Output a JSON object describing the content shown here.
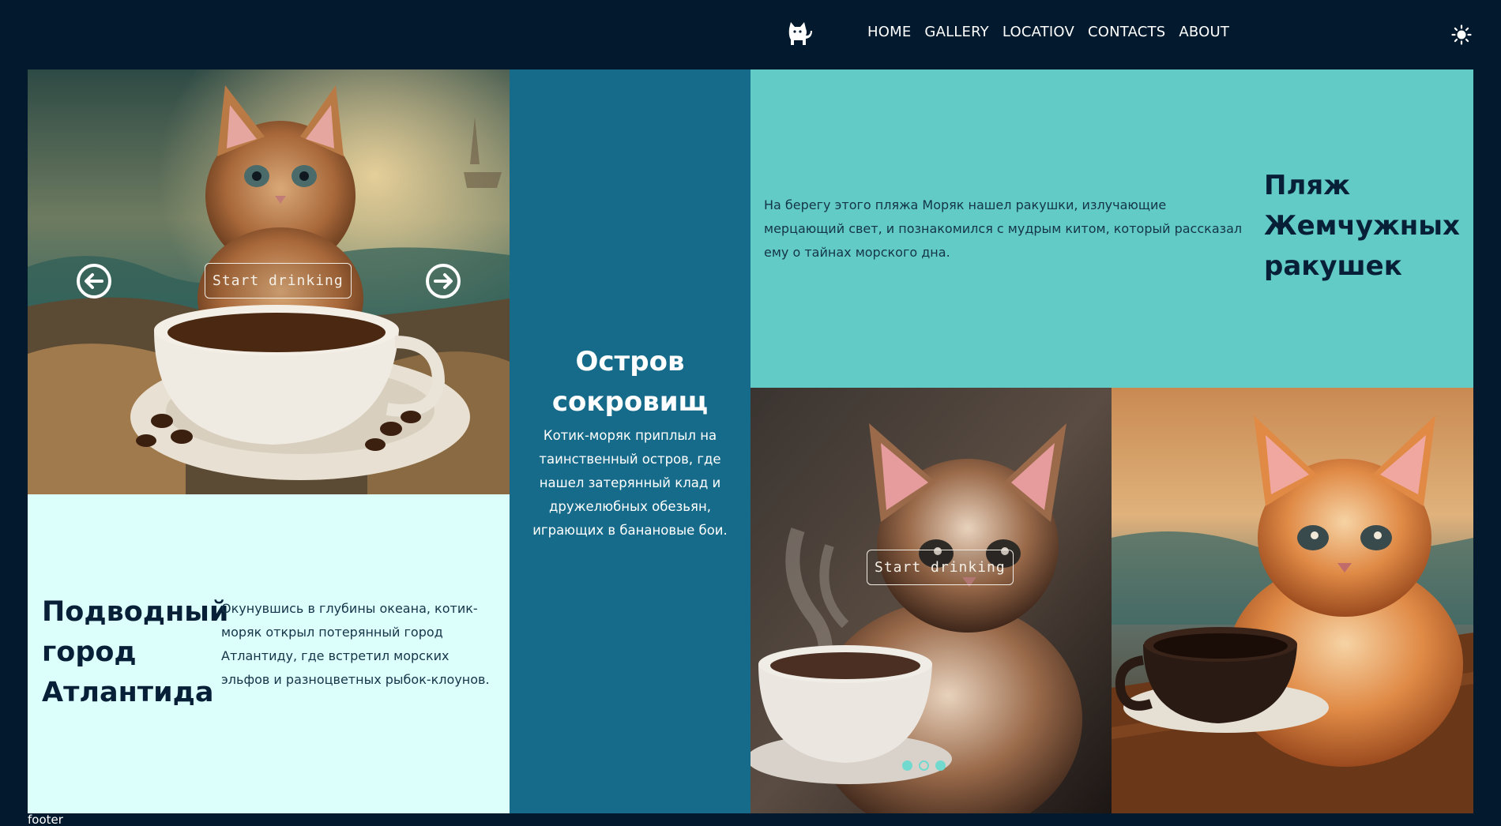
{
  "header": {
    "logo_icon": "cat-icon",
    "nav": [
      {
        "label": "HOME"
      },
      {
        "label": "GALLERY"
      },
      {
        "label": "LOCATIOV"
      },
      {
        "label": "CONTACTS"
      },
      {
        "label": "ABOUT"
      }
    ],
    "theme_icon": "sun-icon"
  },
  "slider": {
    "start_label": "Start drinking",
    "prev_icon": "arrow-left-icon",
    "next_icon": "arrow-right-icon"
  },
  "atlantis": {
    "title": "Подводный город Атлантида",
    "text": "Окунувшись в глубины океана, котик-моряк открыл потерянный город Атлантиду, где встретил морских эльфов и разноцветных рыбок-клоунов."
  },
  "treasure": {
    "title": "Остров сокровищ",
    "text": "Котик-моряк приплыл на таинственный остров, где нашел затерянный клад и дружелюбных обезьян, играющих в банановые бои."
  },
  "pearl": {
    "title": "Пляж Жемчужных ракушек",
    "text": "На берегу этого пляжа Моряк нашел ракушки, излучающие мерцающий свет, и познакомился с мудрым китом, который рассказал ему о тайнах морского дна."
  },
  "gallery": {
    "start_label": "Start drinking",
    "dots": [
      {
        "state": "active"
      },
      {
        "state": "inactive"
      },
      {
        "state": "active"
      }
    ]
  },
  "footer": {
    "text": "footer"
  },
  "colors": {
    "background": "#031a2e",
    "teal": "#63cbc5",
    "deep_blue": "#176b8a",
    "mint": "#dcfffb"
  }
}
